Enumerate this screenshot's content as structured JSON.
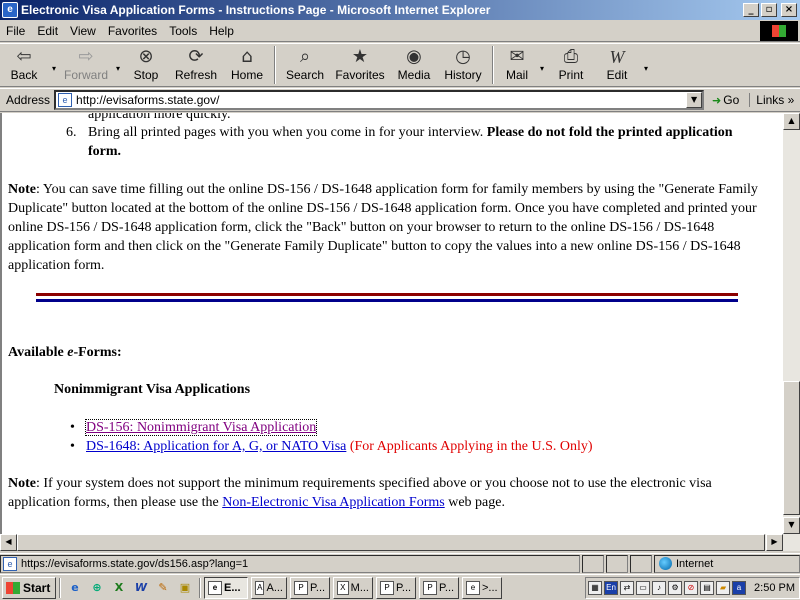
{
  "window": {
    "title": "Electronic Visa Application Forms - Instructions Page - Microsoft Internet Explorer",
    "minimize": "_",
    "maximize": "▫",
    "close": "×"
  },
  "menu": [
    "File",
    "Edit",
    "View",
    "Favorites",
    "Tools",
    "Help"
  ],
  "toolbar": {
    "back": "Back",
    "forward": "Forward",
    "stop": "Stop",
    "refresh": "Refresh",
    "home": "Home",
    "search": "Search",
    "favorites": "Favorites",
    "media": "Media",
    "history": "History",
    "mail": "Mail",
    "print": "Print",
    "edit": "Edit"
  },
  "address": {
    "label": "Address",
    "url": "http://evisaforms.state.gov/",
    "go": "Go",
    "links": "Links"
  },
  "content": {
    "partial_line": "application more quickly.",
    "step6_number": "6.",
    "step6_text": "Bring all printed pages with you when you come in for your interview.",
    "step6_bold": "Please do not fold the printed application form",
    "step6_end": ".",
    "note_label": "Note",
    "note1_text": ": You can save time filling out the online DS-156 / DS-1648 application form for family members by using the \"Generate Family Duplicate\" button located at the bottom of the online DS-156 / DS-1648 application form. Once you have completed and printed your online DS-156 / DS-1648 application form, click the \"Back\" button on your browser to return to the online DS-156 / DS-1648 application form and then click on the \"Generate Family Duplicate\" button to copy the values into a new online DS-156 / DS-1648 application form.",
    "available_prefix": "Available ",
    "available_em": "e",
    "available_suffix": "-Forms:",
    "subheading": "Nonimmigrant Visa Applications",
    "link_ds156": "DS-156: Nonimmigrant Visa Application",
    "link_ds1648": "DS-1648: Application for A, G, or NATO Visa",
    "ds1648_note": "(For Applicants Applying in the U.S. Only)",
    "note2_text": ": If your system does not support the minimum requirements specified above or you choose not to use the electronic visa application forms, then please use the",
    "link_nonelectronic": "Non-Electronic Visa Application Forms",
    "note2_end": "web page."
  },
  "status": {
    "url": "https://evisaforms.state.gov/ds156.asp?lang=1",
    "zone": "Internet"
  },
  "taskbar": {
    "start": "Start",
    "tasks": [
      "E...",
      "A...",
      "P...",
      "M...",
      "P...",
      "P...",
      ">..."
    ],
    "clock": "2:50 PM"
  }
}
